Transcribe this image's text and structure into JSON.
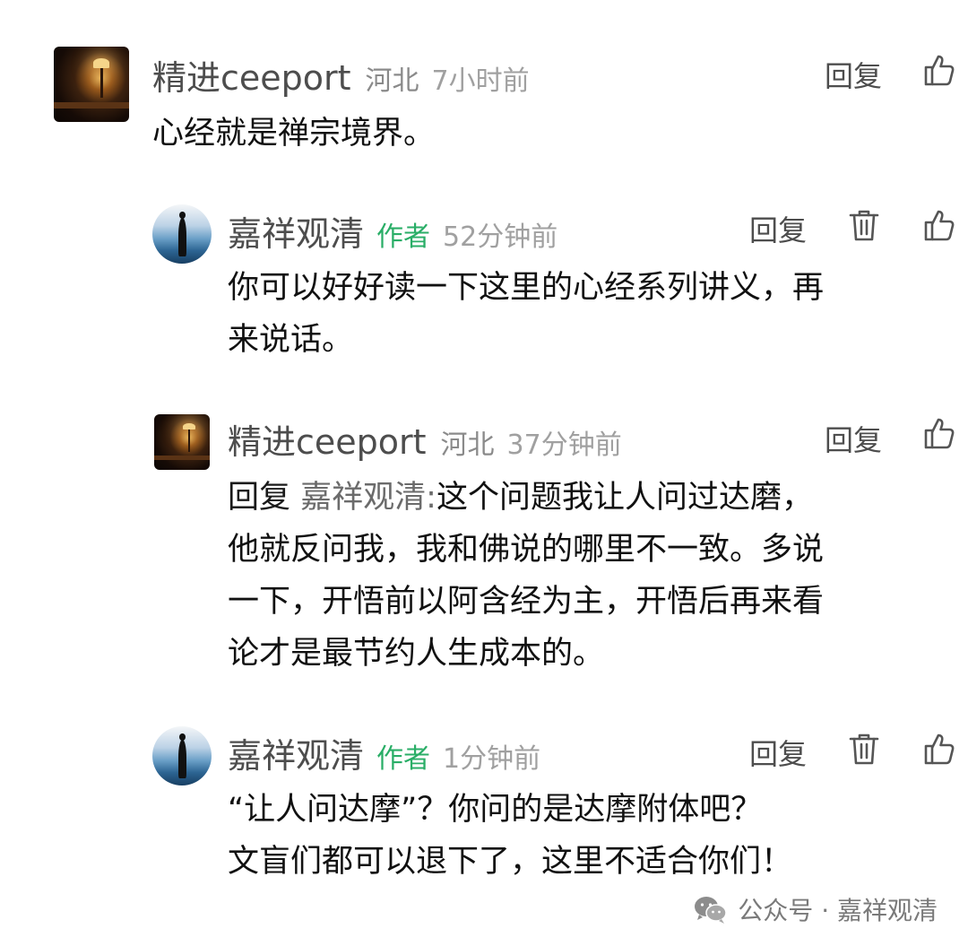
{
  "comments": [
    {
      "name": "精进ceeport",
      "region": "河北",
      "time": "7小时前",
      "reply_label": "回复",
      "text": "心经就是禅宗境界。"
    },
    {
      "name": "嘉祥观清",
      "author_tag": "作者",
      "time": "52分钟前",
      "reply_label": "回复",
      "text_lines": [
        "你可以好好读一下这里的心经系列讲义，再",
        "来说话。"
      ]
    },
    {
      "name": "精进ceeport",
      "region": "河北",
      "time": "37分钟前",
      "reply_label": "回复",
      "reply_prefix": "回复",
      "reply_target": "嘉祥观清:",
      "first_line_rest": "这个问题我让人问过达磨，",
      "text_lines": [
        "他就反问我，我和佛说的哪里不一致。多说",
        "一下，开悟前以阿含经为主，开悟后再来看",
        "论才是最节约人生成本的。"
      ]
    },
    {
      "name": "嘉祥观清",
      "author_tag": "作者",
      "time": "1分钟前",
      "reply_label": "回复",
      "text_lines": [
        "“让人问达摩”？你问的是达摩附体吧？",
        "文盲们都可以退下了，这里不适合你们！"
      ]
    }
  ],
  "watermark": {
    "text": "公众号 · 嘉祥观清",
    "icon": "wechat-icon"
  },
  "icons": {
    "like": "thumbs-up-icon",
    "delete": "trash-icon"
  },
  "colors": {
    "author_tag": "#2aae67",
    "name": "#4d4d4d",
    "meta": "#a0a0a0"
  }
}
